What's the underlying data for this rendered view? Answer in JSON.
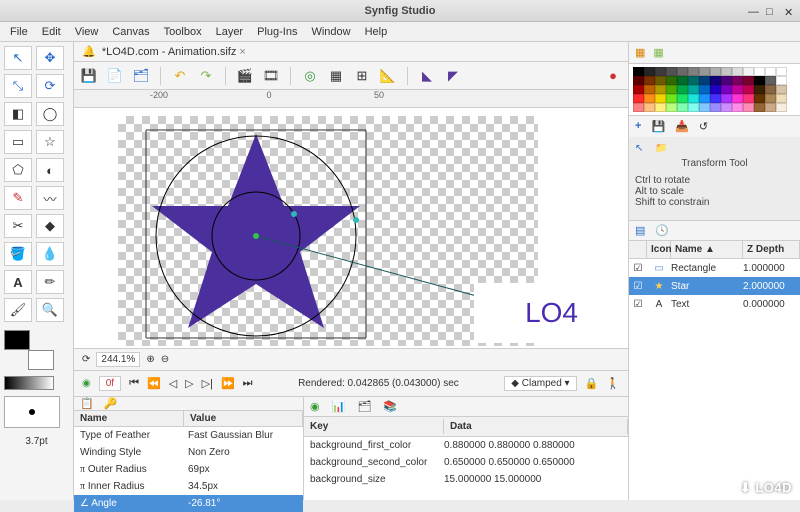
{
  "window": {
    "title": "Synfig Studio"
  },
  "menu": [
    "File",
    "Edit",
    "View",
    "Canvas",
    "Toolbox",
    "Layer",
    "Plug-Ins",
    "Window",
    "Help"
  ],
  "document": {
    "title": "*LO4D.com - Animation.sifz"
  },
  "ruler_marks": [
    "-200",
    "0",
    "50"
  ],
  "canvas_text": "LO4",
  "brush_size_label": "3.7pt",
  "status": {
    "zoom": "244.1%",
    "frame": "0f",
    "render_text": "Rendered: 0.042865 (0.043000) sec",
    "interp": "Clamped"
  },
  "params": {
    "cols": [
      "Name",
      "Value"
    ],
    "rows": [
      {
        "n": "Type of Feather",
        "v": "Fast Gaussian Blur"
      },
      {
        "n": "Winding Style",
        "v": "Non Zero"
      },
      {
        "n": "Outer Radius",
        "v": "69px",
        "pi": true
      },
      {
        "n": "Inner Radius",
        "v": "34.5px",
        "pi": true
      },
      {
        "n": "Angle",
        "v": "-26.81°",
        "sel": true
      }
    ]
  },
  "metadata": {
    "cols": [
      "Key",
      "Data"
    ],
    "rows": [
      {
        "k": "background_first_color",
        "d": "0.880000 0.880000 0.880000"
      },
      {
        "k": "background_second_color",
        "d": "0.650000 0.650000 0.650000"
      },
      {
        "k": "background_size",
        "d": "15.000000 15.000000"
      }
    ]
  },
  "tool_options": {
    "title": "Transform Tool",
    "hints": [
      "Ctrl to rotate",
      "Alt to scale",
      "Shift to constrain"
    ]
  },
  "layers": {
    "cols": [
      "Icon",
      "Name ▲",
      "Z Depth"
    ],
    "rows": [
      {
        "icon": "▭",
        "name": "Rectangle",
        "z": "1.000000",
        "color": "#5b8dd6"
      },
      {
        "icon": "★",
        "name": "Star",
        "z": "2.000000",
        "sel": true,
        "color": "#ffd24a"
      },
      {
        "icon": "A",
        "name": "Text",
        "z": "0.000000",
        "color": "#333"
      }
    ]
  },
  "palette": [
    [
      "#000000",
      "#252525",
      "#3b3b3b",
      "#525252",
      "#696969",
      "#808080",
      "#979797",
      "#aeaeae",
      "#c5c5c5",
      "#dcdcdc",
      "#f3f3f3",
      "#ffffff",
      "#ffffff",
      "#ffffff"
    ],
    [
      "#5b0000",
      "#7a3000",
      "#6b5c00",
      "#2f6b00",
      "#006b2b",
      "#006b66",
      "#003e7a",
      "#12007a",
      "#4d007a",
      "#7a0062",
      "#7a0030",
      "#000000",
      "#606060",
      "#ffffff"
    ],
    [
      "#a80000",
      "#c26100",
      "#b09a00",
      "#4fa800",
      "#00a847",
      "#00a8a0",
      "#0067c2",
      "#2200c2",
      "#7c00c2",
      "#c2009d",
      "#c20050",
      "#3a1f00",
      "#886644",
      "#d8c4a8"
    ],
    [
      "#ff2a2a",
      "#ff8c1a",
      "#f2d500",
      "#6fe61a",
      "#1ae666",
      "#1ae6da",
      "#1a93ff",
      "#4433ff",
      "#aa33ff",
      "#ff33d6",
      "#ff337a",
      "#663300",
      "#aa8855",
      "#eeddbb"
    ],
    [
      "#ff8080",
      "#ffc080",
      "#fff080",
      "#b8ff80",
      "#80ffb0",
      "#80fff0",
      "#80c8ff",
      "#9a8cff",
      "#d08cff",
      "#ff8ce8",
      "#ff8cb4",
      "#996633",
      "#ccaa88",
      "#f7eedd"
    ]
  ],
  "watermark": "⬇ LO4D"
}
